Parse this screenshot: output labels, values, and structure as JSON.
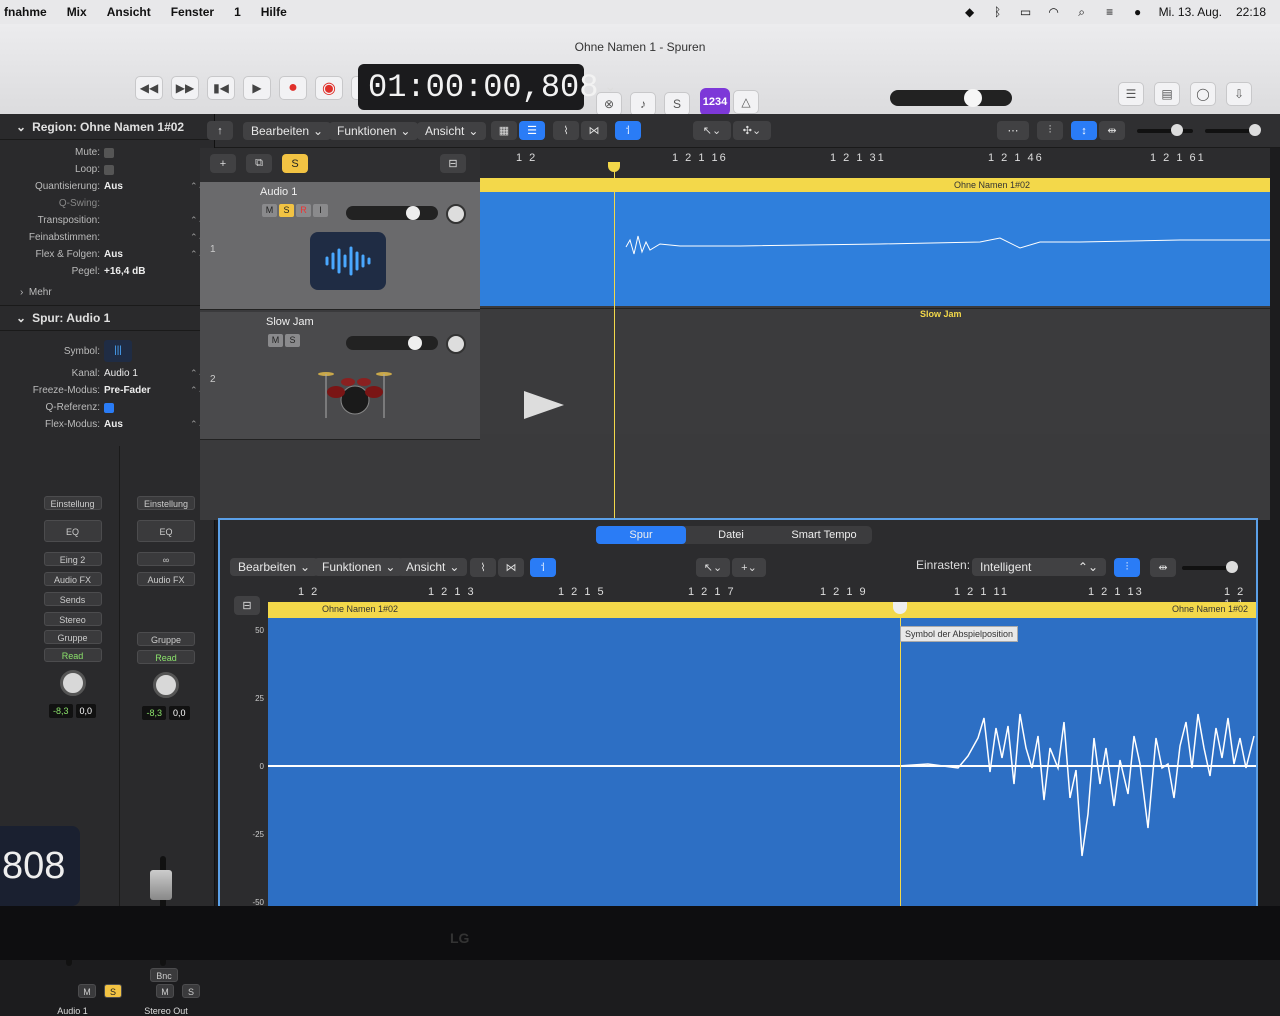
{
  "menubar": {
    "items": [
      "fnahme",
      "Mix",
      "Ansicht",
      "Fenster",
      "1",
      "Hilfe"
    ],
    "date": "Mi. 13. Aug.",
    "time": "22:18"
  },
  "window": {
    "title": "Ohne Namen 1 - Spuren"
  },
  "transport": {
    "time": "01:00:00,808",
    "count_in": "1234"
  },
  "inspector": {
    "region_header": "Region: Ohne Namen 1#02",
    "region_params": [
      {
        "label": "Mute:",
        "value": ""
      },
      {
        "label": "Loop:",
        "value": ""
      },
      {
        "label": "Quantisierung:",
        "value": "Aus"
      },
      {
        "label": "Q-Swing:",
        "value": ""
      },
      {
        "label": "Transposition:",
        "value": ""
      },
      {
        "label": "Feinabstimmen:",
        "value": ""
      },
      {
        "label": "Flex & Folgen:",
        "value": "Aus"
      },
      {
        "label": "Pegel:",
        "value": "+16,4 dB"
      }
    ],
    "more": "Mehr",
    "track_header": "Spur:  Audio 1",
    "track_params": [
      {
        "label": "Symbol:",
        "value": ""
      },
      {
        "label": "Kanal:",
        "value": "Audio 1"
      },
      {
        "label": "Freeze-Modus:",
        "value": "Pre-Fader"
      },
      {
        "label": "Q-Referenz:",
        "value": ""
      },
      {
        "label": "Flex-Modus:",
        "value": "Aus"
      }
    ],
    "strip1": {
      "setting": "Einstellung",
      "eq": "EQ",
      "input": "Eing 2",
      "fx": "Audio FX",
      "sends": "Sends",
      "stereo": "Stereo",
      "group": "Gruppe",
      "auto": "Read",
      "gain": "-8,3",
      "pan": "0,0",
      "name": "Audio 1"
    },
    "strip2": {
      "setting": "Einstellung",
      "eq": "EQ",
      "fx": "Audio FX",
      "group": "Gruppe",
      "auto": "Read",
      "gain": "-8,3",
      "pan": "0,0",
      "bnc": "Bnc",
      "name": "Stereo Out"
    },
    "mute": "M",
    "solo": "S"
  },
  "tracks_toolbar": {
    "edit": "Bearbeiten",
    "functions": "Funktionen",
    "view": "Ansicht"
  },
  "tracks": [
    {
      "number": "1",
      "name": "Audio 1"
    },
    {
      "number": "2",
      "name": "Slow Jam"
    }
  ],
  "ruler": [
    "1 2",
    "1 2 1 16",
    "1 2 1 31",
    "1 2 1 46",
    "1 2 1 61"
  ],
  "regions": {
    "audio": "Ohne Namen 1#02",
    "drummer": "Slow Jam"
  },
  "editor": {
    "tabs": [
      "Spur",
      "Datei",
      "Smart Tempo"
    ],
    "edit": "Bearbeiten",
    "functions": "Funktionen",
    "view": "Ansicht",
    "snap_label": "Einrasten:",
    "snap_value": "Intelligent",
    "ruler": [
      "1 2",
      "1 2 1 3",
      "1 2 1 5",
      "1 2 1 7",
      "1 2 1 9",
      "1 2 1 11",
      "1 2 1 13",
      "1 2 1 1"
    ],
    "region_left": "Ohne Namen 1#02",
    "region_right": "Ohne Namen 1#02",
    "tooltip": "Symbol der Abspielposition",
    "axis": [
      "50",
      "25",
      "0",
      "-25",
      "-50"
    ]
  },
  "overlay_time": "808",
  "bezel_logo": "LG"
}
